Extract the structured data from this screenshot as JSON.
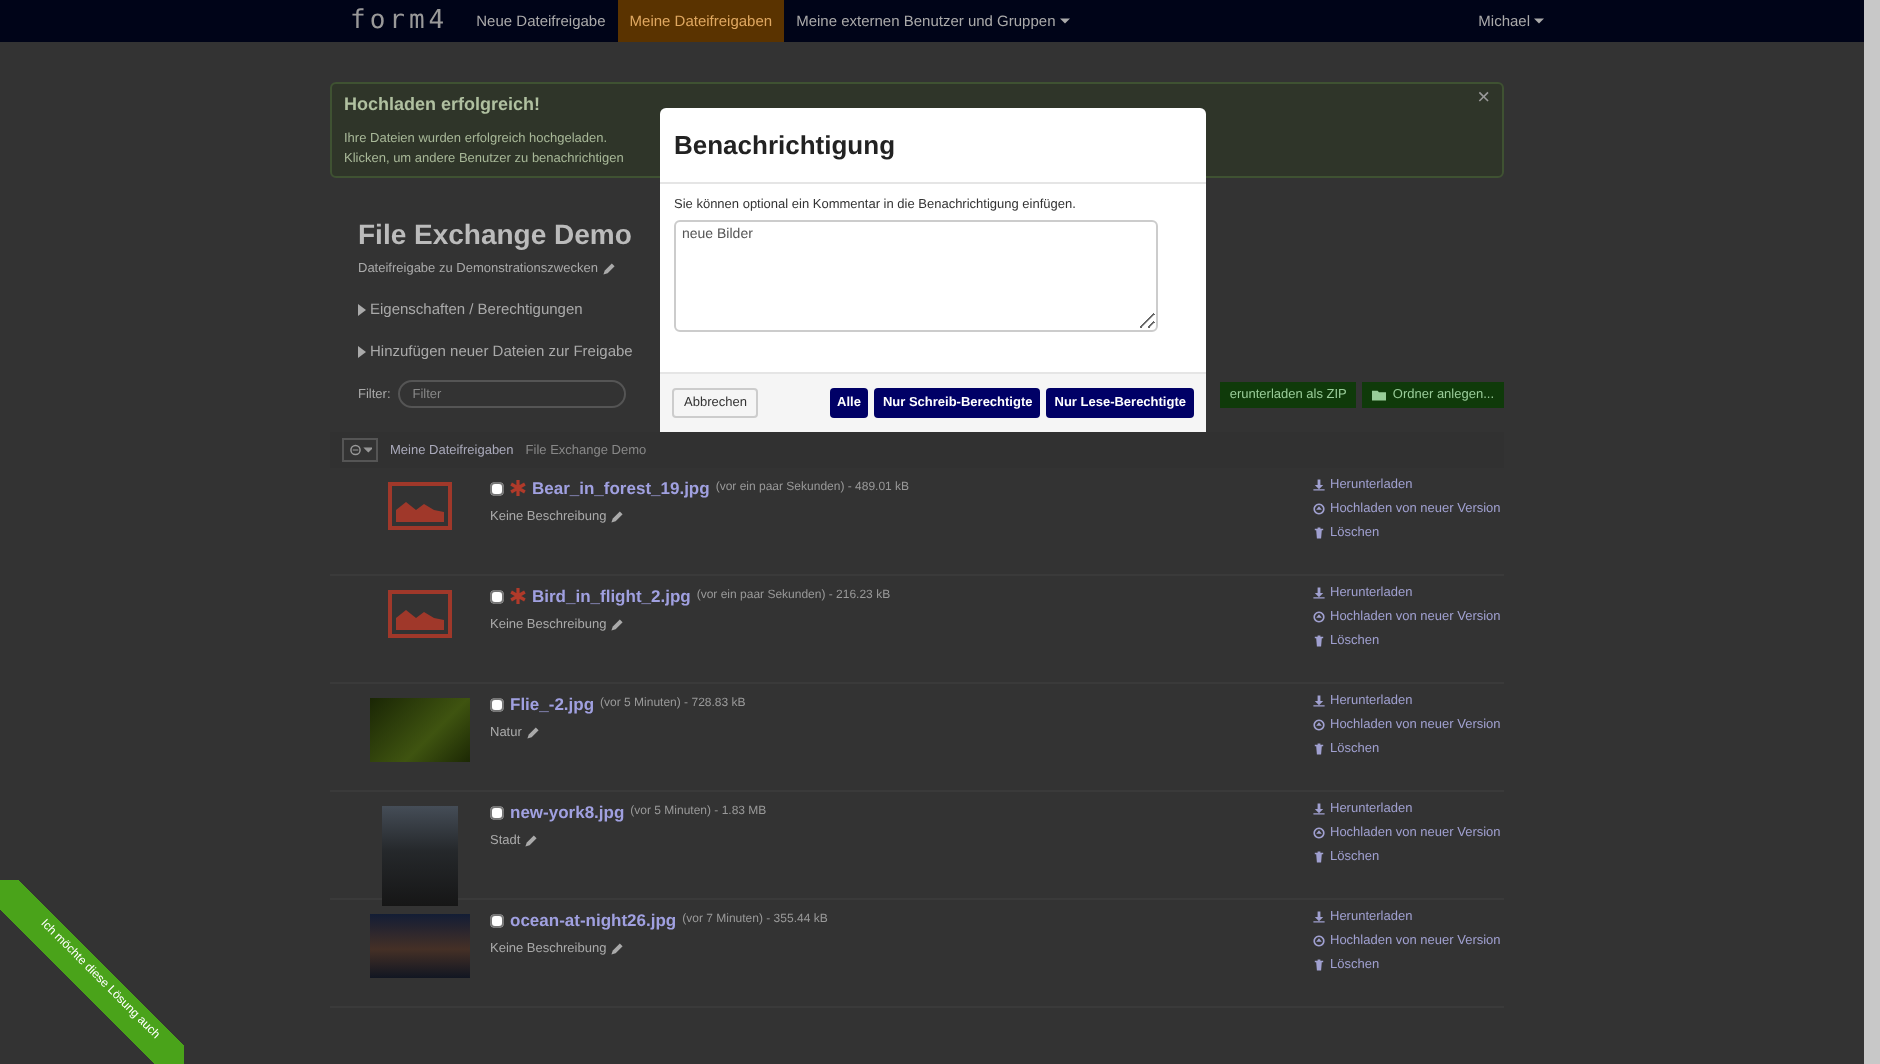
{
  "navbar": {
    "logo": "form4",
    "items": [
      {
        "label": "Neue Dateifreigabe",
        "selected": false,
        "dropdown": false
      },
      {
        "label": "Meine Dateifreigaben",
        "selected": true,
        "dropdown": false
      },
      {
        "label": "Meine externen Benutzer und Gruppen",
        "selected": false,
        "dropdown": true
      }
    ],
    "user": "Michael"
  },
  "alert": {
    "title": "Hochladen erfolgreich!",
    "lines": [
      "Ihre Dateien wurden erfolgreich hochgeladen.",
      "Klicken, um andere Benutzer zu benachrichtigen"
    ],
    "close": "×"
  },
  "share": {
    "title": "File Exchange Demo",
    "description": "Dateifreigabe zu Demonstrationszwecken"
  },
  "sections": [
    "Eigenschaften / Berechtigungen",
    "Hinzufügen neuer Dateien zur Freigabe"
  ],
  "filter": {
    "label": "Filter:",
    "placeholder": "Filter"
  },
  "actions": [
    "erunterladen als ZIP",
    "Ordner anlegen..."
  ],
  "breadcrumb": [
    "Meine Dateifreigaben",
    "File Exchange Demo"
  ],
  "files": [
    {
      "name": "Bear_in_forest_19.jpg",
      "new": true,
      "meta": "(vor ein paar Sekunden) - 489.01 kB",
      "description": "Keine Beschreibung",
      "kind": "missing",
      "checked": false,
      "actions": [
        "Herunterladen",
        "Hochladen von neuer Version",
        "Löschen"
      ]
    },
    {
      "name": "Bird_in_flight_2.jpg",
      "new": true,
      "meta": "(vor ein paar Sekunden) - 216.23 kB",
      "description": "Keine Beschreibung",
      "kind": "missing",
      "checked": false,
      "actions": [
        "Herunterladen",
        "Hochladen von neuer Version",
        "Löschen"
      ]
    },
    {
      "name": "Flie_-2.jpg",
      "new": false,
      "meta": "(vor 5 Minuten) - 728.83 kB",
      "description": "Natur",
      "kind": "forest",
      "checked": false,
      "actions": [
        "Herunterladen",
        "Hochladen von neuer Version",
        "Löschen"
      ]
    },
    {
      "name": "new-york8.jpg",
      "new": false,
      "meta": "(vor 5 Minuten) - 1.83 MB",
      "description": "Stadt",
      "kind": "city",
      "checked": false,
      "actions": [
        "Herunterladen",
        "Hochladen von neuer Version",
        "Löschen"
      ]
    },
    {
      "name": "ocean-at-night26.jpg",
      "new": false,
      "meta": "(vor 7 Minuten) - 355.44 kB",
      "description": "Keine Beschreibung",
      "kind": "ocean",
      "checked": false,
      "actions": [
        "Herunterladen",
        "Hochladen von neuer Version",
        "Löschen"
      ]
    }
  ],
  "modal": {
    "title": "Benachrichtigung",
    "text": "Sie können optional ein Kommentar in die Benachrichtigung einfügen.",
    "comment": "neue Bilder",
    "cancel": "Abbrechen",
    "buttons": [
      "Alle",
      "Nur Schreib-Berechtigte",
      "Nur Lese-Berechtigte"
    ]
  },
  "ribbon": "Ich möchte diese Lösung auch"
}
